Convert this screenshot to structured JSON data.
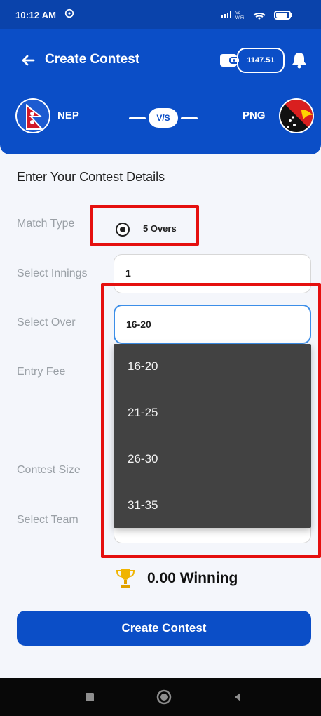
{
  "status_bar": {
    "time": "10:12 AM"
  },
  "app_bar": {
    "title": "Create Contest",
    "wallet_balance": "1147.51"
  },
  "match": {
    "team_left": "NEP",
    "team_right": "PNG",
    "vs": "V/S"
  },
  "form": {
    "section_title": "Enter Your Contest Details",
    "labels": {
      "match_type": "Match Type",
      "select_innings": "Select Innings",
      "select_over": "Select Over",
      "entry_fee": "Entry Fee",
      "contest_size": "Contest Size",
      "select_team": "Select Team"
    },
    "match_type_option": "5 Overs",
    "innings_value": "1",
    "over_value": "16-20",
    "dropdown_options": [
      "16-20",
      "21-25",
      "26-30",
      "31-35"
    ]
  },
  "summary": {
    "winning": "0.00 Winning"
  },
  "actions": {
    "create_contest": "Create Contest"
  },
  "colors": {
    "primary": "#0b4ec7",
    "highlight": "#e5100f",
    "dropdown_bg": "#424242"
  },
  "icons": {
    "back": "back-arrow-icon",
    "wallet": "wallet-icon",
    "bell": "bell-icon",
    "trophy": "trophy-icon",
    "nav_recent": "recent-apps-icon",
    "nav_home": "home-icon",
    "nav_back": "nav-back-icon"
  }
}
